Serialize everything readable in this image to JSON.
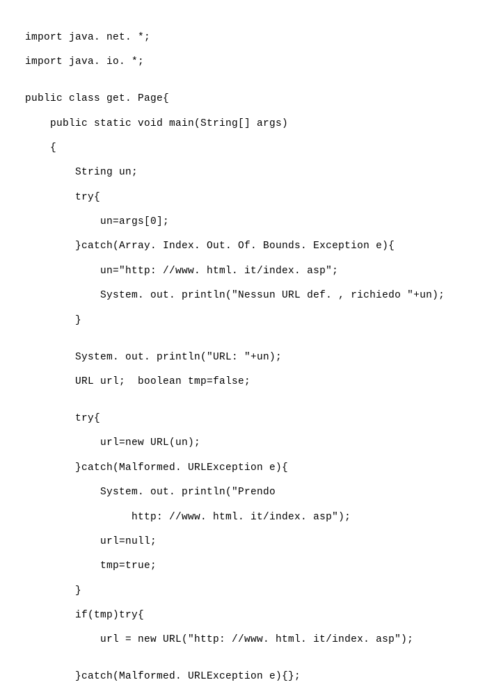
{
  "code": {
    "lines": [
      "import java. net. *;",
      "import java. io. *;",
      "",
      "public class get. Page{",
      "    public static void main(String[] args)",
      "    {",
      "        String un;",
      "        try{",
      "            un=args[0];",
      "        }catch(Array. Index. Out. Of. Bounds. Exception e){",
      "            un=\"http: //www. html. it/index. asp\";",
      "            System. out. println(\"Nessun URL def. , richiedo \"+un);",
      "        }",
      "",
      "        System. out. println(\"URL: \"+un);",
      "        URL url;  boolean tmp=false;",
      "",
      "        try{",
      "            url=new URL(un);",
      "        }catch(Malformed. URLException e){",
      "            System. out. println(\"Prendo",
      "                 http: //www. html. it/index. asp\");",
      "            url=null;",
      "            tmp=true;",
      "        }",
      "        if(tmp)try{",
      "            url = new URL(\"http: //www. html. it/index. asp\");",
      "",
      "        }catch(Malformed. URLException e){};"
    ]
  }
}
